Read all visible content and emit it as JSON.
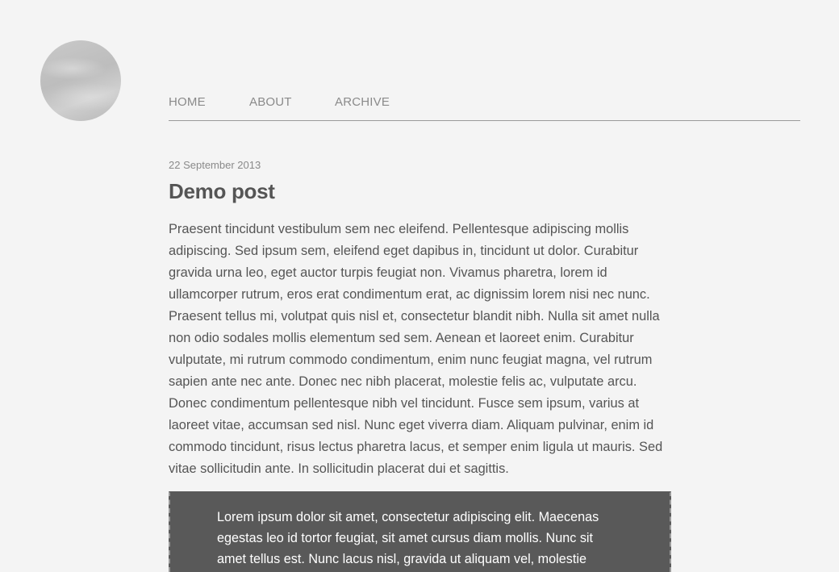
{
  "header": {
    "avatar_icon": "avatar-image",
    "nav": {
      "home": "HOME",
      "about": "ABOUT",
      "archive": "ARCHIVE"
    }
  },
  "post": {
    "date": "22 September 2013",
    "title": "Demo post",
    "body": "Praesent tincidunt vestibulum sem nec eleifend. Pellentesque adipiscing mollis adipiscing. Sed ipsum sem, eleifend eget dapibus in, tincidunt ut dolor. Curabitur gravida urna leo, eget auctor turpis feugiat non. Vivamus pharetra, lorem id ullamcorper rutrum, eros erat condimentum erat, ac dignissim lorem nisi nec nunc. Praesent tellus mi, volutpat quis nisl et, consectetur blandit nibh. Nulla sit amet nulla non odio sodales mollis elementum sed sem. Aenean et laoreet enim. Curabitur vulputate, mi rutrum commodo condimentum, enim nunc feugiat magna, vel rutrum sapien ante nec ante. Donec nec nibh placerat, molestie felis ac, vulputate arcu. Donec condimentum pellentesque nibh vel tincidunt. Fusce sem ipsum, varius at laoreet vitae, accumsan sed nisl. Nunc eget viverra diam. Aliquam pulvinar, enim id commodo tincidunt, risus lectus pharetra lacus, et semper enim ligula ut mauris. Sed vitae sollicitudin ante. In sollicitudin placerat dui et sagittis.",
    "quote": "Lorem ipsum dolor sit amet, consectetur adipiscing elit. Maecenas egestas leo id tortor feugiat, sit amet cursus diam mollis. Nunc sit amet tellus est. Nunc lacus nisl, gravida ut aliquam vel, molestie"
  },
  "colors": {
    "background": "#f4f4f4",
    "text": "#555555",
    "muted": "#8a8a8a",
    "quote_background": "#595959"
  }
}
